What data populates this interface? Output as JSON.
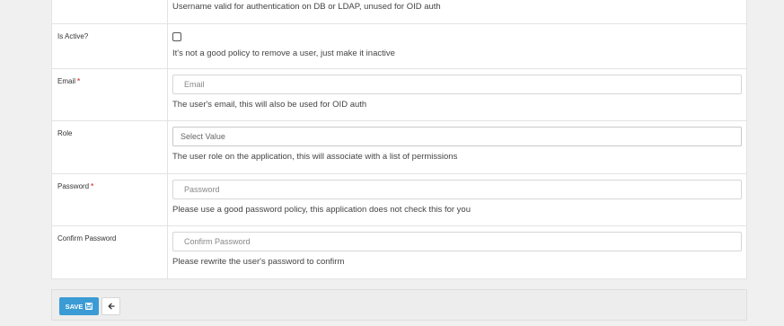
{
  "form": {
    "username_help": "Username valid for authentication on DB or LDAP, unused for OID auth",
    "active": {
      "label": "Is Active?",
      "checked": false,
      "help": "It's not a good policy to remove a user, just make it inactive"
    },
    "email": {
      "label": "Email",
      "required_mark": "*",
      "placeholder": "Email",
      "help": "The user's email, this will also be used for OID auth"
    },
    "role": {
      "label": "Role",
      "selected": "Select Value",
      "help": "The user role on the application, this will associate with a list of permissions"
    },
    "password": {
      "label": "Password",
      "required_mark": "*",
      "placeholder": "Password",
      "help": "Please use a good password policy, this application does not check this for you"
    },
    "confirm_password": {
      "label": "Confirm Password",
      "placeholder": "Confirm Password",
      "help": "Please rewrite the user's password to confirm"
    }
  },
  "actions": {
    "save_label": "SAVE",
    "save_icon": "floppy-disk-icon",
    "back_icon": "arrow-left-icon"
  },
  "colors": {
    "accent": "#3a9bd5",
    "required": "#d9534f"
  }
}
